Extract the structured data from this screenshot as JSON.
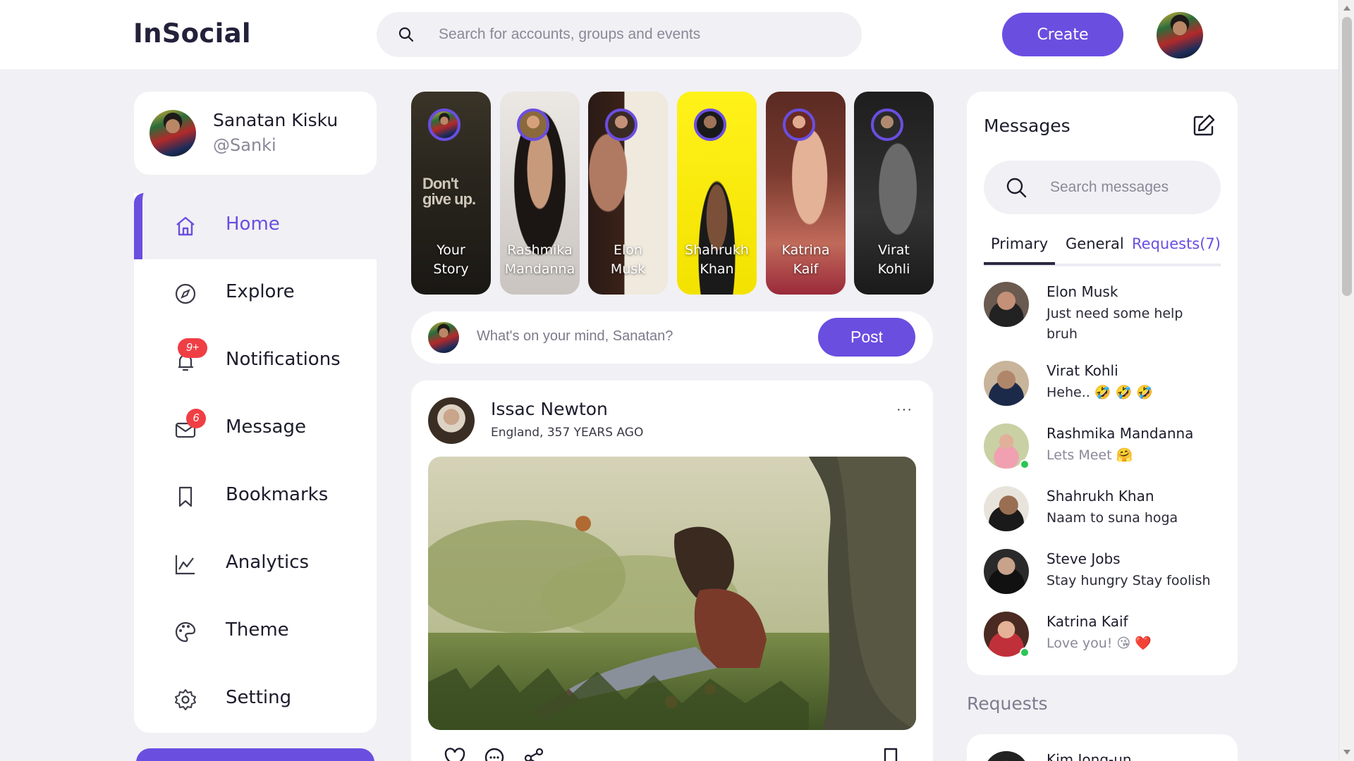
{
  "app": {
    "name": "InSocial"
  },
  "header": {
    "search_placeholder": "Search for accounts, groups and events",
    "create_label": "Create",
    "user_avatar": "avatar-photo"
  },
  "profile": {
    "name": "Sanatan Kisku",
    "handle": "@Sanki"
  },
  "sidebar": {
    "items": [
      {
        "label": "Home",
        "icon": "home-icon",
        "active": true
      },
      {
        "label": "Explore",
        "icon": "compass-icon"
      },
      {
        "label": "Notifications",
        "icon": "bell-icon",
        "badge": "9+"
      },
      {
        "label": "Message",
        "icon": "mail-icon",
        "badge": "6"
      },
      {
        "label": "Bookmarks",
        "icon": "bookmark-icon"
      },
      {
        "label": "Analytics",
        "icon": "chart-icon"
      },
      {
        "label": "Theme",
        "icon": "palette-icon"
      },
      {
        "label": "Setting",
        "icon": "gear-icon"
      }
    ]
  },
  "stories": [
    {
      "name_line1": "Your",
      "name_line2": "Story",
      "overlay": "Don't give up."
    },
    {
      "name_line1": "Rashmika",
      "name_line2": "Mandanna"
    },
    {
      "name_line1": "Elon",
      "name_line2": "Musk"
    },
    {
      "name_line1": "Shahrukh",
      "name_line2": "Khan"
    },
    {
      "name_line1": "Katrina",
      "name_line2": "Kaif"
    },
    {
      "name_line1": "Virat",
      "name_line2": "Kohli"
    }
  ],
  "composer": {
    "placeholder": "What's on your mind, Sanatan?",
    "post_label": "Post"
  },
  "feed": {
    "author": "Issac Newton",
    "meta": "England, 357 YEARS AGO",
    "more": "···"
  },
  "messages": {
    "title": "Messages",
    "search_placeholder": "Search messages",
    "tabs": [
      {
        "label": "Primary",
        "active": true
      },
      {
        "label": "General"
      },
      {
        "label": "Requests(7)",
        "accent": true
      }
    ],
    "items": [
      {
        "name": "Elon Musk",
        "text": "Just need some help bruh",
        "online": false,
        "muted": false
      },
      {
        "name": "Virat Kohli",
        "text": "Hehe.. 🤣 🤣 🤣",
        "online": false,
        "muted": false
      },
      {
        "name": "Rashmika Mandanna",
        "text": "Lets Meet 🤗",
        "online": true,
        "muted": true
      },
      {
        "name": "Shahrukh Khan",
        "text": "Naam to suna hoga",
        "online": false,
        "muted": false
      },
      {
        "name": "Steve Jobs",
        "text": "Stay hungry Stay foolish",
        "online": false,
        "muted": false
      },
      {
        "name": "Katrina Kaif",
        "text": "Love you! 😘 ❤️",
        "online": true,
        "muted": true
      }
    ]
  },
  "requests": {
    "title": "Requests",
    "first_name": "Kim Jong-un"
  },
  "colors": {
    "accent": "#6a4ee0",
    "badge": "#ef3f45",
    "online": "#29c655",
    "bg": "#f1f0f4"
  }
}
